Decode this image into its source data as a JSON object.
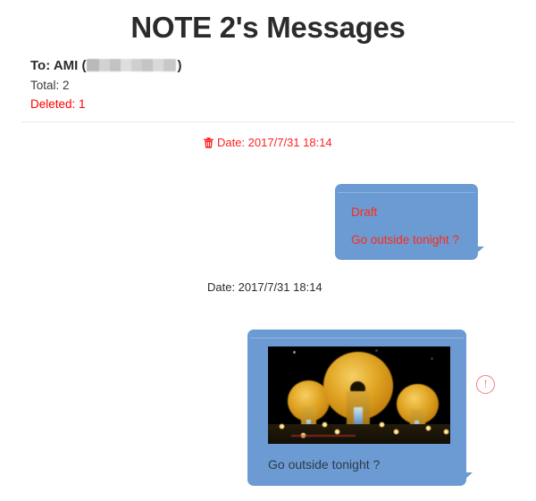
{
  "page": {
    "title": "NOTE 2's Messages"
  },
  "summary": {
    "to_label": "To: AMI (",
    "to_close": ")",
    "to_redacted": "redacted-recipient-number",
    "total": "Total: 2",
    "deleted": "Deleted: 1"
  },
  "colors": {
    "bubble": "#6b9bd2",
    "bubble_rule": "#8fb5de",
    "deleted_red": "#ff0000",
    "draft_red": "#ff2a18",
    "alert": "#f08080",
    "title": "#2b2b2b",
    "divider": "#e8e8e8"
  },
  "messages": [
    {
      "id": "message-1",
      "deleted": true,
      "date": "Date: 2017/7/31 18:14",
      "trash_icon": "trash-icon",
      "status_label": "Draft",
      "body": "Go outside tonight ?",
      "has_photo": false
    },
    {
      "id": "message-2",
      "deleted": false,
      "date": "Date: 2017/7/31 18:14",
      "body": "Go outside tonight ?",
      "has_photo": true,
      "photo_alt": "night-scene-illuminated-domes",
      "alert_icon": "exclamation-circle-icon",
      "alert_glyph": "!"
    }
  ]
}
